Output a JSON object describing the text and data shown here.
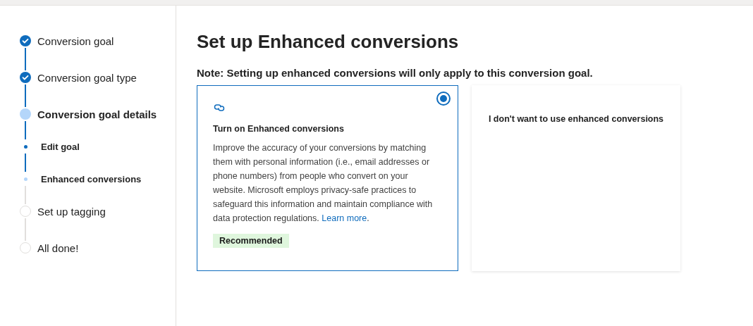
{
  "steps": [
    {
      "label": "Conversion goal",
      "kind": "step",
      "completed": true,
      "current": false
    },
    {
      "label": "Conversion goal type",
      "kind": "step",
      "completed": true,
      "current": false
    },
    {
      "label": "Conversion goal details",
      "kind": "step",
      "completed": false,
      "current": true
    },
    {
      "label": "Edit goal",
      "kind": "substep",
      "completed": true,
      "current": false
    },
    {
      "label": "Enhanced conversions",
      "kind": "substep",
      "completed": false,
      "current": true
    },
    {
      "label": "Set up tagging",
      "kind": "step",
      "completed": false,
      "current": false
    },
    {
      "label": "All done!",
      "kind": "step",
      "completed": false,
      "current": false
    }
  ],
  "title": "Set up Enhanced conversions",
  "note": "Note: Setting up enhanced conversions will only apply to this conversion goal.",
  "options": [
    {
      "selected": true,
      "title": "Turn on Enhanced conversions",
      "description": "Improve the accuracy of your conversions by matching them with personal information (i.e., email addresses or phone numbers) from people who convert on your website. Microsoft employs privacy-safe practices to safeguard this information and maintain compliance with data protection regulations.",
      "link": "Learn more",
      "after_link": ".",
      "badge": "Recommended"
    },
    {
      "selected": false,
      "title": "I don't want to use enhanced conversions"
    }
  ]
}
